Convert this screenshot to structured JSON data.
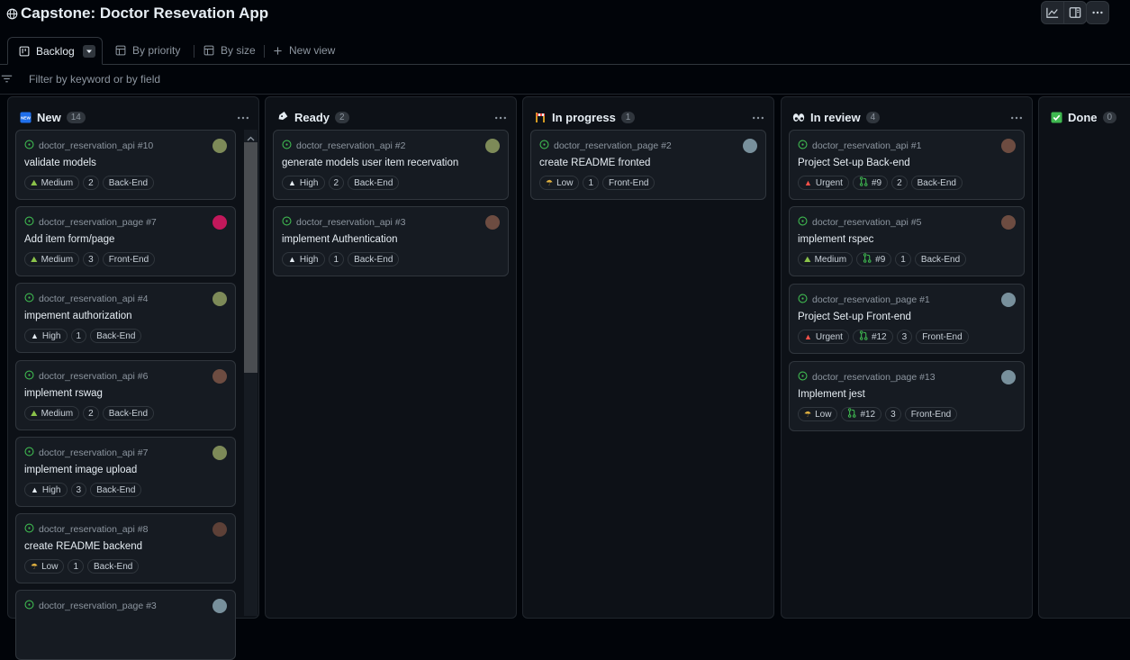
{
  "header": {
    "title": "Capstone: Doctor Resevation App"
  },
  "tabs": [
    {
      "label": "Backlog",
      "icon": "board-icon"
    },
    {
      "label": "By priority",
      "icon": "table-icon"
    },
    {
      "label": "By size",
      "icon": "table-icon"
    },
    {
      "label": "New view",
      "icon": "plus-icon"
    }
  ],
  "filter": {
    "placeholder": "Filter by keyword or by field"
  },
  "columns": [
    {
      "title": "New",
      "count": "14",
      "emoji": "new-button-emoji",
      "cards": [
        {
          "repo": "doctor_reservation_api #10",
          "title": "validate models",
          "priority": "Medium",
          "size": "2",
          "label": "Back-End",
          "avatar": "#7d8a58"
        },
        {
          "repo": "doctor_reservation_page #7",
          "title": "Add item form/page",
          "priority": "Medium",
          "size": "3",
          "label": "Front-End",
          "avatar": "#c2185b"
        },
        {
          "repo": "doctor_reservation_api #4",
          "title": "impement authorization",
          "priority": "High",
          "size": "1",
          "label": "Back-End",
          "avatar": "#7d8a58"
        },
        {
          "repo": "doctor_reservation_api #6",
          "title": "implement rswag",
          "priority": "Medium",
          "size": "2",
          "label": "Back-End",
          "avatar": "#6d4c41"
        },
        {
          "repo": "doctor_reservation_api #7",
          "title": "implement image upload",
          "priority": "High",
          "size": "3",
          "label": "Back-End",
          "avatar": "#7d8a58"
        },
        {
          "repo": "doctor_reservation_api #8",
          "title": "create README backend",
          "priority": "Low",
          "size": "1",
          "label": "Back-End",
          "avatar": "#5d4037"
        },
        {
          "repo": "doctor_reservation_page #3",
          "title": "",
          "priority": "",
          "size": "",
          "label": "",
          "avatar": "#78909c"
        }
      ]
    },
    {
      "title": "Ready",
      "count": "2",
      "emoji": "label-emoji",
      "cards": [
        {
          "repo": "doctor_reservation_api #2",
          "title": "generate models user item recervation",
          "priority": "High",
          "size": "2",
          "label": "Back-End",
          "avatar": "#7d8a58"
        },
        {
          "repo": "doctor_reservation_api #3",
          "title": "implement Authentication",
          "priority": "High",
          "size": "1",
          "label": "Back-End",
          "avatar": "#6d4c41"
        }
      ]
    },
    {
      "title": "In progress",
      "count": "1",
      "emoji": "construction-emoji",
      "cards": [
        {
          "repo": "doctor_reservation_page #2",
          "title": "create README fronted",
          "priority": "Low",
          "size": "1",
          "label": "Front-End",
          "avatar": "#78909c"
        }
      ]
    },
    {
      "title": "In review",
      "count": "4",
      "emoji": "eyes-emoji",
      "cards": [
        {
          "repo": "doctor_reservation_api #1",
          "title": "Project Set-up Back-end",
          "priority": "Urgent",
          "pr": "#9",
          "size": "2",
          "label": "Back-End",
          "avatar": "#6d4c41"
        },
        {
          "repo": "doctor_reservation_api #5",
          "title": "implement rspec",
          "priority": "Medium",
          "pr": "#9",
          "size": "1",
          "label": "Back-End",
          "avatar": "#6d4c41"
        },
        {
          "repo": "doctor_reservation_page #1",
          "title": "Project Set-up Front-end",
          "priority": "Urgent",
          "pr": "#12",
          "size": "3",
          "label": "Front-End",
          "avatar": "#78909c"
        },
        {
          "repo": "doctor_reservation_page #13",
          "title": "Implement jest",
          "priority": "Low",
          "pr": "#12",
          "size": "3",
          "label": "Front-End",
          "avatar": "#78909c"
        }
      ]
    },
    {
      "title": "Done",
      "count": "0",
      "emoji": "check-mark-emoji",
      "cards": []
    }
  ],
  "colors": {
    "open_issue": "#3fb950",
    "accent_bg": "#0d1117",
    "border": "#30363d"
  }
}
